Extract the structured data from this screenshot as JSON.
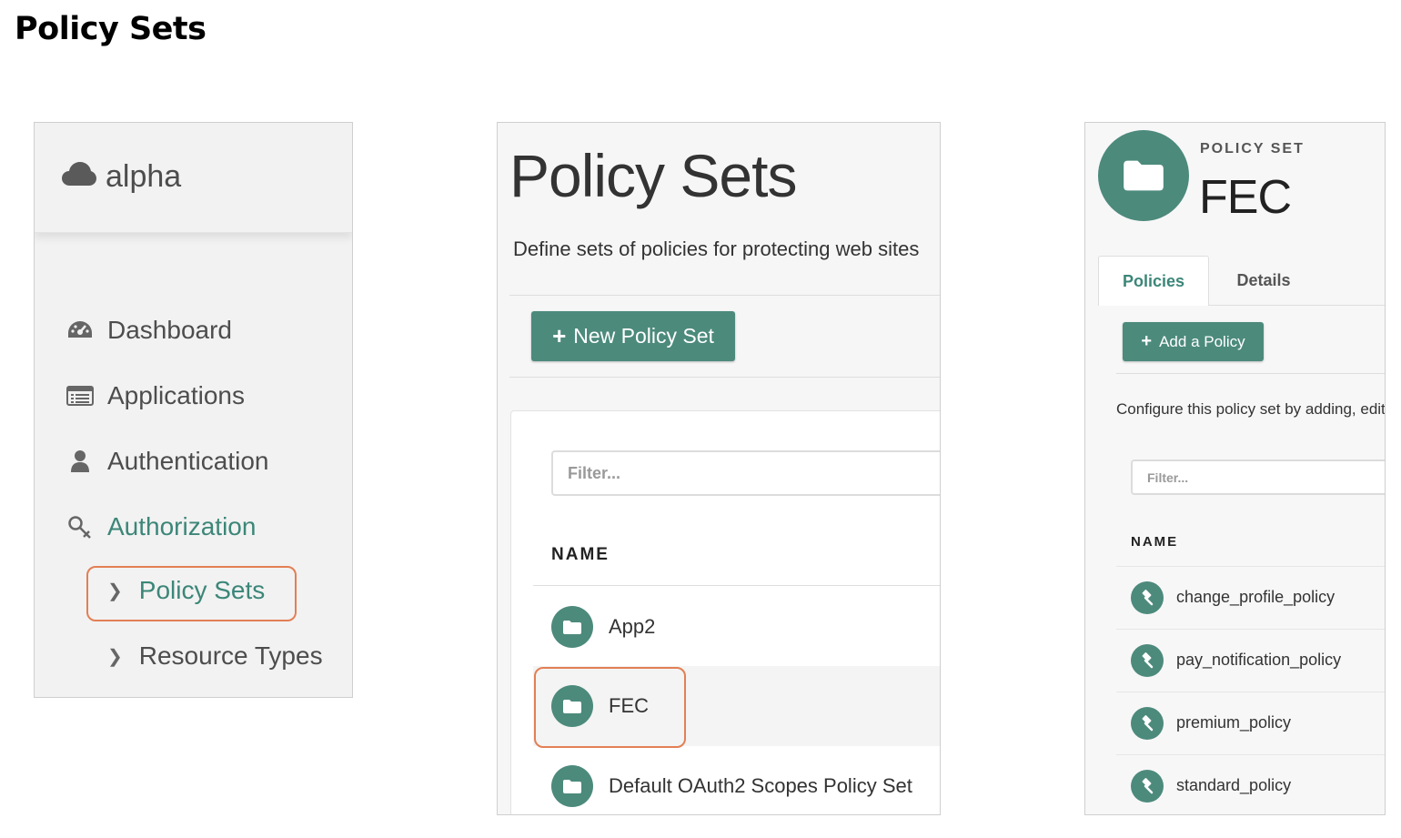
{
  "page": {
    "heading": "Policy Sets"
  },
  "sidebar": {
    "realm": "alpha",
    "nav": [
      {
        "label": "Dashboard",
        "icon": "dashboard-icon"
      },
      {
        "label": "Applications",
        "icon": "applications-icon"
      },
      {
        "label": "Authentication",
        "icon": "user-icon"
      },
      {
        "label": "Authorization",
        "icon": "key-icon"
      }
    ],
    "sub_items": [
      {
        "label": "Policy Sets"
      },
      {
        "label": "Resource Types"
      }
    ]
  },
  "list": {
    "title": "Policy Sets",
    "description": "Define sets of policies for protecting web sites",
    "new_button": "New Policy Set",
    "filter_placeholder": "Filter...",
    "column_name": "NAME",
    "rows": [
      {
        "name": "App2"
      },
      {
        "name": "FEC"
      },
      {
        "name": "Default OAuth2 Scopes Policy Set"
      }
    ]
  },
  "detail": {
    "eyebrow": "POLICY SET",
    "name": "FEC",
    "tabs": [
      "Policies",
      "Details"
    ],
    "add_button": "Add a Policy",
    "description": "Configure this policy set by adding, editing and removing policies.",
    "filter_placeholder": "Filter...",
    "column_name": "NAME",
    "policies": [
      {
        "name": "change_profile_policy"
      },
      {
        "name": "pay_notification_policy"
      },
      {
        "name": "premium_policy"
      },
      {
        "name": "standard_policy"
      }
    ]
  },
  "colors": {
    "accent": "#4c8a7c",
    "highlight": "#e37f55"
  }
}
